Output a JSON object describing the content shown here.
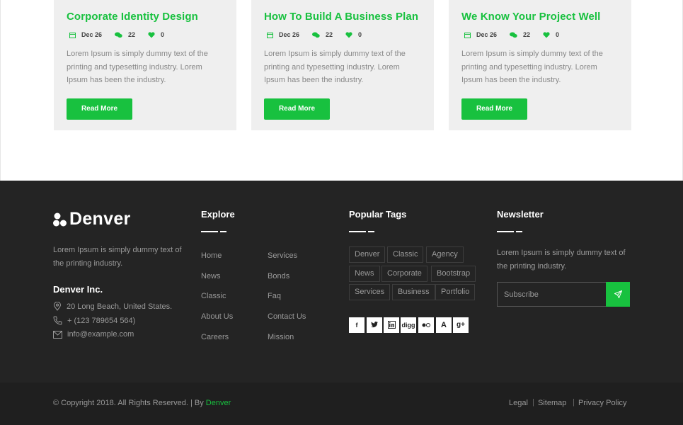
{
  "cards": [
    {
      "title": "Corporate Identity Design",
      "date": "Dec 26",
      "comments": "22",
      "likes": "0",
      "text": "Lorem Ipsum is simply dummy text of the printing and typesetting industry. Lorem Ipsum has been the industry.",
      "button": "Read More"
    },
    {
      "title": "How To Build A Business Plan",
      "date": "Dec 26",
      "comments": "22",
      "likes": "0",
      "text": "Lorem Ipsum is simply dummy text of the printing and typesetting industry. Lorem Ipsum has been the industry.",
      "button": "Read More"
    },
    {
      "title": "We Know Your Project Well",
      "date": "Dec 26",
      "comments": "22",
      "likes": "0",
      "text": "Lorem Ipsum is simply dummy text of the printing and typesetting industry. Lorem Ipsum has been the industry.",
      "button": "Read More"
    }
  ],
  "footer": {
    "brand": "Denver",
    "about": "Lorem Ipsum is simply dummy text of the printing industry.",
    "company": "Denver Inc.",
    "address": "20 Long Beach, United States.",
    "phone": "+ (123 789654 564)",
    "email": "info@example.com",
    "explore_title": "Explore",
    "explore_left": [
      "Home",
      "News",
      "Classic",
      "About Us",
      "Careers"
    ],
    "explore_right": [
      "Services",
      "Bonds",
      "Faq",
      "Contact Us",
      "Mission"
    ],
    "tags_title": "Popular Tags",
    "tags": [
      "Denver",
      "Classic",
      "Agency",
      "News",
      "Corporate",
      "Bootstrap",
      "Services",
      "Business",
      "Portfolio"
    ],
    "social": [
      "f",
      "t",
      "in",
      "digg",
      "flickr",
      "A",
      "g+"
    ],
    "newsletter_title": "Newsletter",
    "newsletter_text": "Lorem Ipsum is simply dummy text of the printing industry.",
    "subscribe_placeholder": "Subscribe"
  },
  "bottom": {
    "copyright": "© Copyright 2018. All Rights Reserved. | By ",
    "copyright_brand": "Denver",
    "links": [
      "Legal",
      "Sitemap",
      "Privacy Policy"
    ]
  },
  "colors": {
    "accent": "#18c13f",
    "footer_bg": "#242424",
    "card_bg": "#efefef"
  }
}
